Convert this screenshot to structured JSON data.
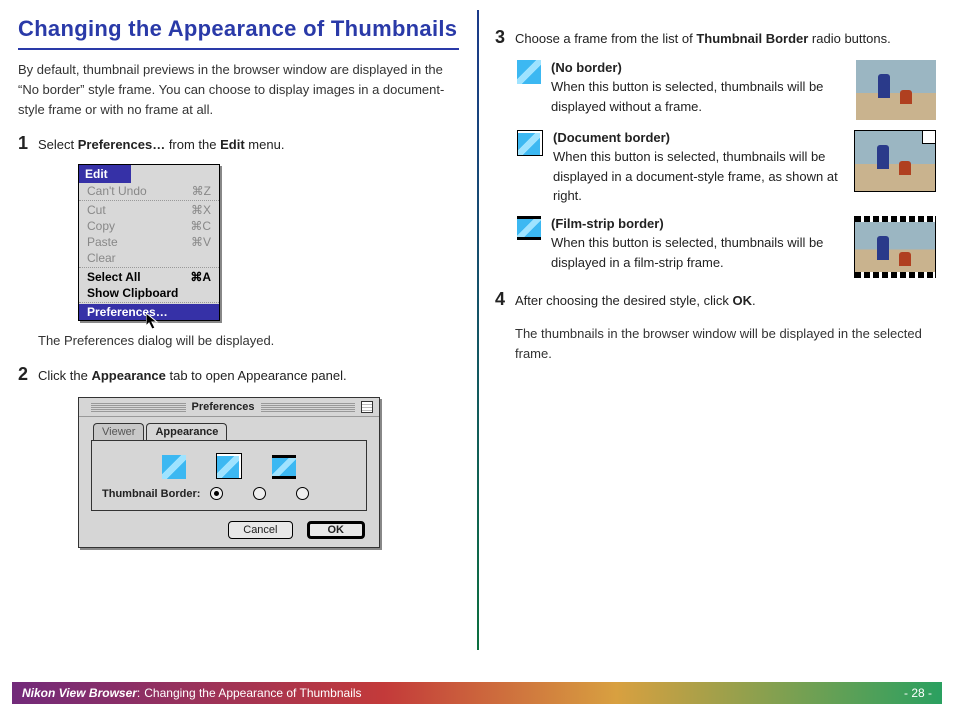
{
  "title": "Changing the Appearance of Thumbnails",
  "intro": "By default, thumbnail previews in the browser window are displayed in the “No border” style frame.  You can choose to display images in a document-style frame or with no frame at all.",
  "step1": {
    "num": "1",
    "pre": "Select ",
    "b1": "Preferences…",
    "mid": " from the ",
    "b2": "Edit",
    "post": " menu."
  },
  "step1_after": "The Preferences dialog will be displayed.",
  "step2": {
    "num": "2",
    "pre": "Click the ",
    "b1": "Appearance",
    "post": " tab to open Appearance panel."
  },
  "step3": {
    "num": "3",
    "pre": "Choose a frame from the list of ",
    "b1": "Thumbnail Border",
    "post": " radio buttons."
  },
  "step4": {
    "num": "4",
    "pre": "After choosing the desired style, click ",
    "b1": "OK",
    "post": "."
  },
  "step4_after": "The thumbnails in the browser window will be displayed in the selected frame.",
  "edit_menu": {
    "title": "Edit",
    "undo": {
      "label": "Can't Undo",
      "key": "⌘Z"
    },
    "cut": {
      "label": "Cut",
      "key": "⌘X"
    },
    "copy": {
      "label": "Copy",
      "key": "⌘C"
    },
    "paste": {
      "label": "Paste",
      "key": "⌘V"
    },
    "clear": {
      "label": "Clear",
      "key": ""
    },
    "selall": {
      "label": "Select All",
      "key": "⌘A"
    },
    "showcb": {
      "label": "Show Clipboard",
      "key": ""
    },
    "prefs": {
      "label": "Preferences…",
      "key": ""
    }
  },
  "prefs_dialog": {
    "title": "Preferences",
    "tab_viewer": "Viewer",
    "tab_appearance": "Appearance",
    "label": "Thumbnail Border:",
    "cancel": "Cancel",
    "ok": "OK"
  },
  "border_styles": {
    "none": {
      "name": "(No border)",
      "desc": "When this button is selected, thumbnails will be displayed without a frame."
    },
    "doc": {
      "name": "(Document border)",
      "desc": "When this button is selected, thumbnails will be displayed in a document-style frame, as shown at right."
    },
    "film": {
      "name": "(Film-strip border)",
      "desc": "When this button is selected, thumbnails will be displayed in a film-strip frame."
    }
  },
  "footer": {
    "product": "Nikon View Browser",
    "sep": ":",
    "title": "Changing the Appearance of Thumbnails",
    "page": "- 28 -"
  }
}
